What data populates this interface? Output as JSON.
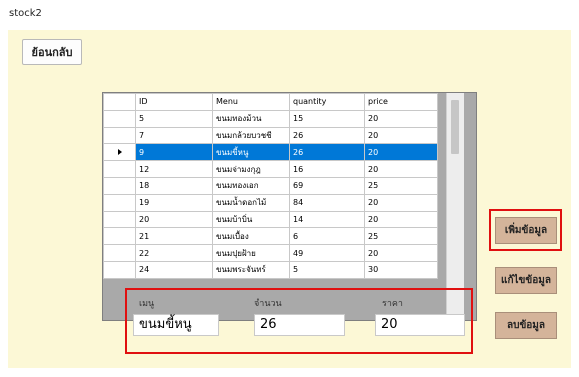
{
  "window": {
    "title": "stock2"
  },
  "back_button": {
    "label": "ย้อนกลับ"
  },
  "grid": {
    "columns": [
      "ID",
      "Menu",
      "quantity",
      "price"
    ],
    "selected_row_index": 2,
    "rows": [
      {
        "id": "5",
        "menu": "ขนมทองม้วน",
        "quantity": "15",
        "price": "20"
      },
      {
        "id": "7",
        "menu": "ขนมกล้วยบวชชี",
        "quantity": "26",
        "price": "20"
      },
      {
        "id": "9",
        "menu": "ขนมขี้หนู",
        "quantity": "26",
        "price": "20"
      },
      {
        "id": "12",
        "menu": "ขนมจ่ามงกุฎ",
        "quantity": "16",
        "price": "20"
      },
      {
        "id": "18",
        "menu": "ขนมทองเอก",
        "quantity": "69",
        "price": "25"
      },
      {
        "id": "19",
        "menu": "ขนมน้ำดอกไม้",
        "quantity": "84",
        "price": "20"
      },
      {
        "id": "20",
        "menu": "ขนมบ้าบิ่น",
        "quantity": "14",
        "price": "20"
      },
      {
        "id": "21",
        "menu": "ขนมเบื้อง",
        "quantity": "6",
        "price": "25"
      },
      {
        "id": "22",
        "menu": "ขนมปุยฝ้าย",
        "quantity": "49",
        "price": "20"
      },
      {
        "id": "24",
        "menu": "ขนมพระจันทร์",
        "quantity": "5",
        "price": "30"
      }
    ]
  },
  "form": {
    "menu_label": "เมนู",
    "menu_value": "ขนมขี้หนู",
    "quantity_label": "จำนวน",
    "quantity_value": "26",
    "price_label": "ราคา",
    "price_value": "20"
  },
  "actions": {
    "add_label": "เพิ่มข้อมูล",
    "edit_label": "แก้ไขข้อมูล",
    "delete_label": "ลบข้อมูล"
  },
  "colors": {
    "form_background": "#fcf8d6",
    "selected_row": "#0078d7",
    "button": "#d4b49a",
    "highlight": "#e01010"
  }
}
